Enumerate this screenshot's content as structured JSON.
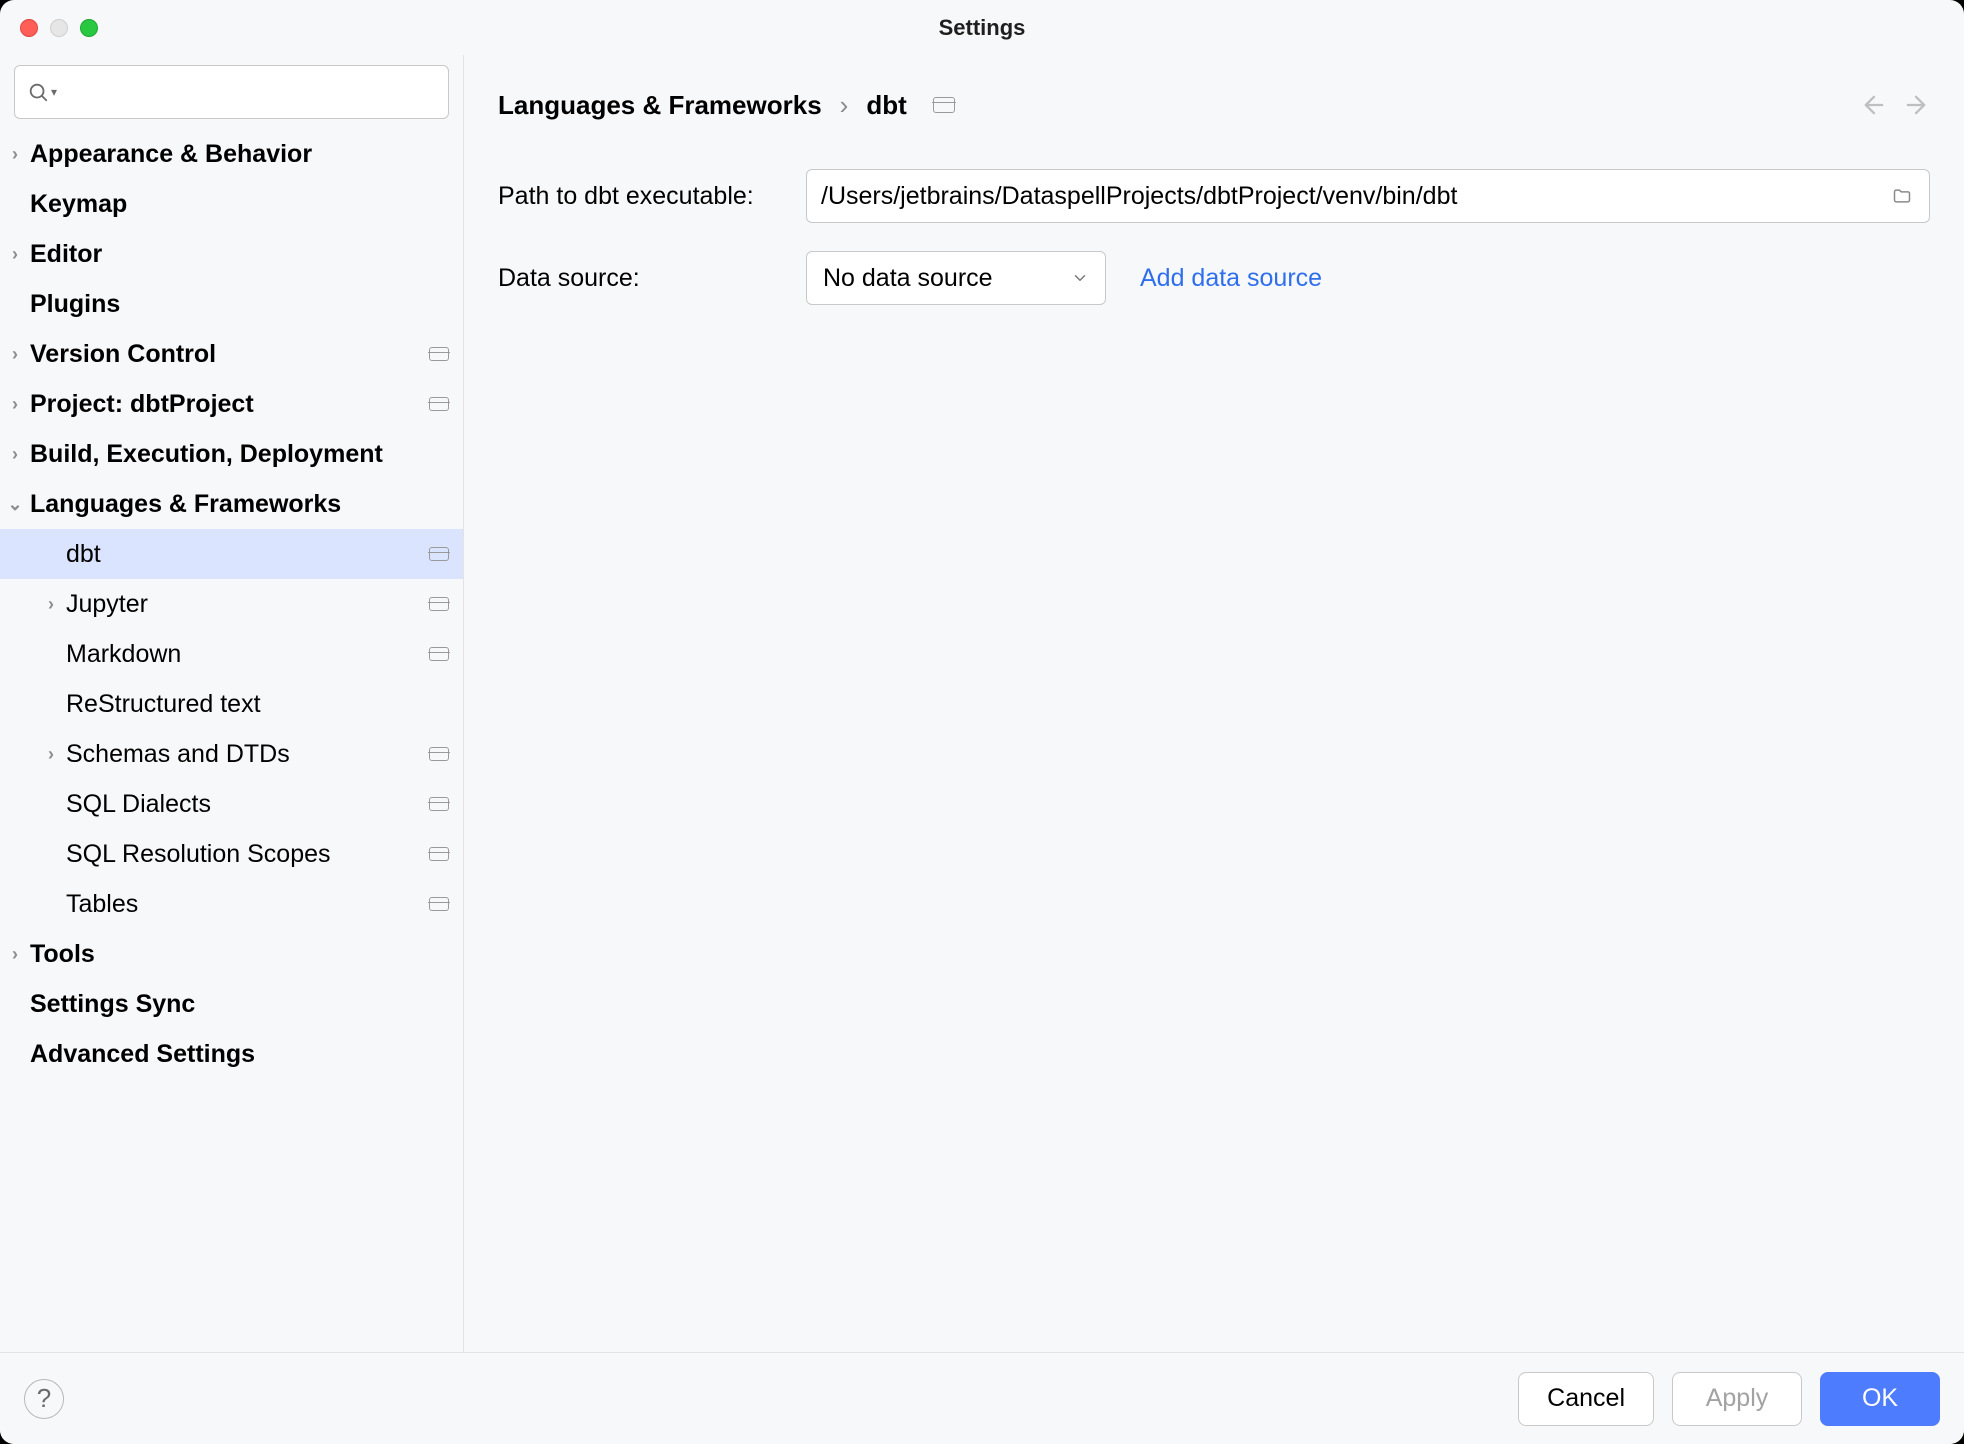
{
  "window": {
    "title": "Settings"
  },
  "sidebar": {
    "search_placeholder": "",
    "items": [
      {
        "label": "Appearance & Behavior",
        "chev": "right",
        "indent": 0,
        "project": false
      },
      {
        "label": "Keymap",
        "chev": "",
        "indent": 0,
        "project": false
      },
      {
        "label": "Editor",
        "chev": "right",
        "indent": 0,
        "project": false
      },
      {
        "label": "Plugins",
        "chev": "",
        "indent": 0,
        "project": false
      },
      {
        "label": "Version Control",
        "chev": "right",
        "indent": 0,
        "project": true
      },
      {
        "label": "Project: dbtProject",
        "chev": "right",
        "indent": 0,
        "project": true
      },
      {
        "label": "Build, Execution, Deployment",
        "chev": "right",
        "indent": 0,
        "project": false
      },
      {
        "label": "Languages & Frameworks",
        "chev": "down",
        "indent": 0,
        "project": false
      },
      {
        "label": "dbt",
        "chev": "",
        "indent": 1,
        "project": true,
        "selected": true
      },
      {
        "label": "Jupyter",
        "chev": "right",
        "indent": 1,
        "project": true
      },
      {
        "label": "Markdown",
        "chev": "",
        "indent": 1,
        "project": true
      },
      {
        "label": "ReStructured text",
        "chev": "",
        "indent": 1,
        "project": false
      },
      {
        "label": "Schemas and DTDs",
        "chev": "right",
        "indent": 1,
        "project": true
      },
      {
        "label": "SQL Dialects",
        "chev": "",
        "indent": 1,
        "project": true
      },
      {
        "label": "SQL Resolution Scopes",
        "chev": "",
        "indent": 1,
        "project": true
      },
      {
        "label": "Tables",
        "chev": "",
        "indent": 1,
        "project": true
      },
      {
        "label": "Tools",
        "chev": "right",
        "indent": 0,
        "project": false
      },
      {
        "label": "Settings Sync",
        "chev": "",
        "indent": 0,
        "project": false
      },
      {
        "label": "Advanced Settings",
        "chev": "",
        "indent": 0,
        "project": false
      }
    ]
  },
  "breadcrumb": {
    "parent": "Languages & Frameworks",
    "sep": "›",
    "current": "dbt"
  },
  "form": {
    "path_label": "Path to dbt executable:",
    "path_value": "/Users/jetbrains/DataspellProjects/dbtProject/venv/bin/dbt",
    "ds_label": "Data source:",
    "ds_selected": "No data source",
    "add_ds_link": "Add data source"
  },
  "footer": {
    "cancel": "Cancel",
    "apply": "Apply",
    "ok": "OK"
  }
}
